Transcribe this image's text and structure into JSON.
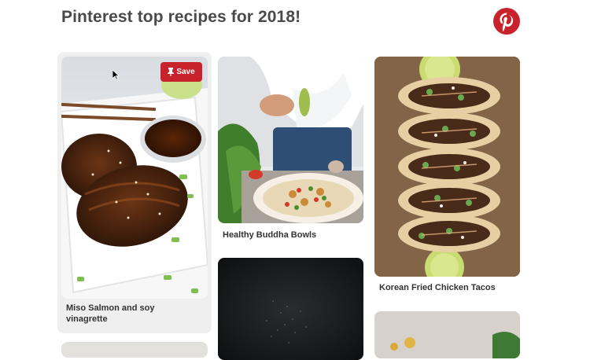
{
  "header": {
    "title": "Pinterest top recipes for 2018!"
  },
  "logo": {
    "icon": "pinterest-logo-icon",
    "color": "#c8232c"
  },
  "pins": [
    {
      "caption": "Miso Salmon and soy vinagrette",
      "image": "miso-salmon-photo"
    },
    {
      "caption": "Healthy Buddha Bowls",
      "image": "buddha-bowl-photo"
    },
    {
      "caption": "Korean Fried Chicken Tacos",
      "image": "chicken-tacos-photo"
    },
    {
      "caption": "",
      "image": "dark-photo"
    },
    {
      "caption": "",
      "image": "light-food-photo"
    },
    {
      "caption": "",
      "image": "bottom-photo"
    }
  ],
  "save_button": {
    "label": "Save",
    "icon": "pin-icon",
    "color": "#c8232c"
  },
  "colors": {
    "accent": "#c8232c",
    "text": "#4a4a4a"
  }
}
